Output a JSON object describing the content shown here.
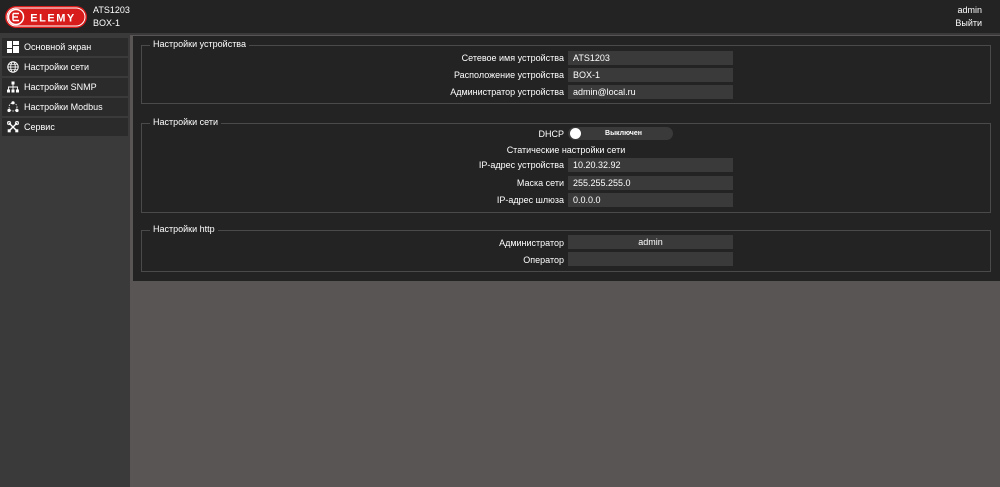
{
  "header": {
    "logo_text": "ELEMY",
    "device_model": "ATS1203",
    "device_name": "BOX-1",
    "user": "admin",
    "logout": "Выйти"
  },
  "sidebar": {
    "items": [
      {
        "label": "Основной экран",
        "icon": "dashboard-icon"
      },
      {
        "label": "Настройки сети",
        "icon": "globe-icon"
      },
      {
        "label": "Настройки SNMP",
        "icon": "network-tree-icon"
      },
      {
        "label": "Настройки Modbus",
        "icon": "modbus-icon"
      },
      {
        "label": "Сервис",
        "icon": "tools-icon"
      }
    ],
    "active_index": 1
  },
  "device_settings": {
    "legend": "Настройки устройства",
    "hostname_label": "Сетевое имя устройства",
    "hostname": "ATS1203",
    "location_label": "Расположение устройства",
    "location": "BOX-1",
    "admin_label": "Администратор устройства",
    "admin": "admin@local.ru"
  },
  "network_settings": {
    "legend": "Настройки сети",
    "dhcp_label": "DHCP",
    "dhcp_state": "Выключен",
    "static_heading": "Статические настройки сети",
    "ip_label": "IP-адрес устройства",
    "ip": "10.20.32.92",
    "mask_label": "Маска сети",
    "mask": "255.255.255.0",
    "gateway_label": "IP-адрес шлюза",
    "gateway": "0.0.0.0"
  },
  "http_settings": {
    "legend": "Настройки http",
    "admin_label": "Администратор",
    "admin": "admin",
    "operator_label": "Оператор",
    "operator": ""
  },
  "colors": {
    "background": "#5a5555",
    "panel": "#232323",
    "sidebar": "#3a3a3a",
    "nav_item": "#2b2b2b",
    "field": "#3a3a3a",
    "logo_red": "#d81b1b"
  }
}
